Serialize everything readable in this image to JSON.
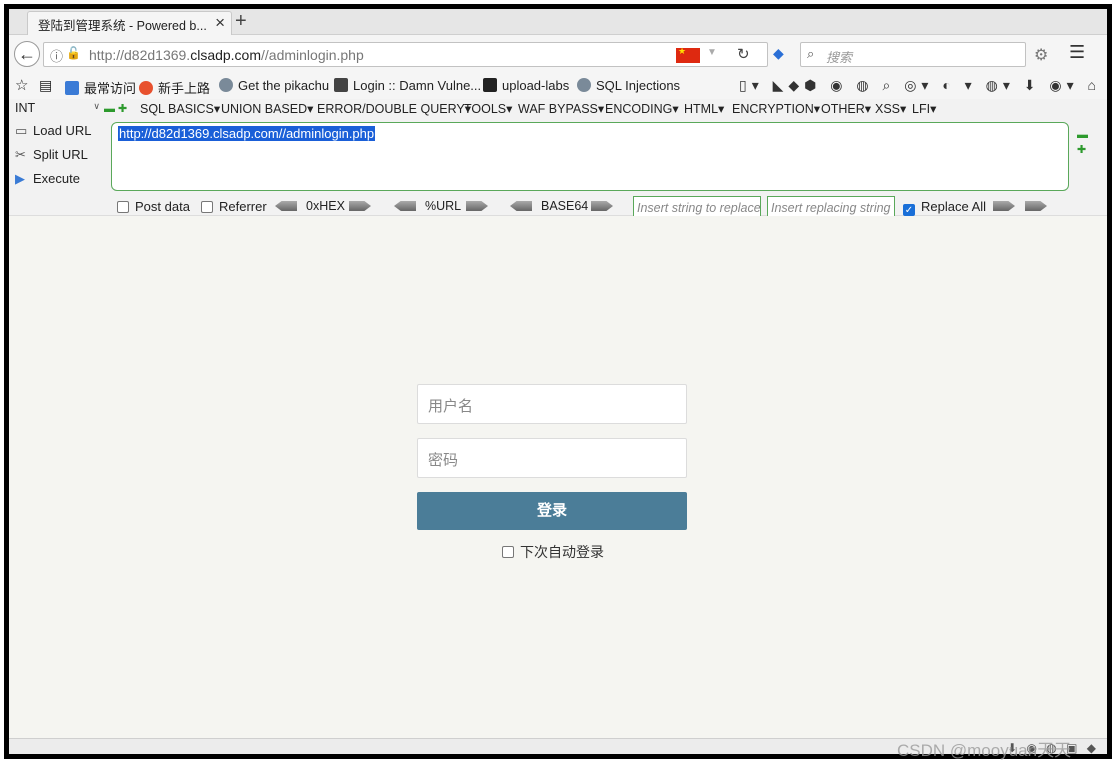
{
  "browser": {
    "tab_title": "登陆到管理系统 - Powered b...",
    "url_prefix": "http://d82d1369.",
    "url_domain": "clsadp.com",
    "url_path": "//adminlogin.php",
    "search_placeholder": "搜索"
  },
  "bookmarks": [
    {
      "label": "最常访问",
      "color": "#3b7bd6"
    },
    {
      "label": "新手上路",
      "color": "#e8512e"
    },
    {
      "label": "Get the pikachu",
      "color": "#7a8a99"
    },
    {
      "label": "Login :: Damn Vulne...",
      "color": "#444444"
    },
    {
      "label": "upload-labs",
      "color": "#222222"
    },
    {
      "label": "SQL Injections",
      "color": "#7a8a99"
    }
  ],
  "hackbar": {
    "type_select": "INT",
    "menus": [
      "SQL BASICS",
      "UNION BASED",
      "ERROR/DOUBLE QUERY",
      "TOOLS",
      "WAF BYPASS",
      "ENCODING",
      "HTML",
      "ENCRYPTION",
      "OTHER",
      "XSS",
      "LFI"
    ],
    "load_url": "Load URL",
    "split_url": "Split URL",
    "execute": "Execute",
    "url_value": "http://d82d1369.clsadp.com//adminlogin.php",
    "post_data": "Post data",
    "referrer": "Referrer",
    "hex": "0xHEX",
    "urlenc": "%URL",
    "base64": "BASE64",
    "replace_from_placeholder": "Insert string to replace",
    "replace_to_placeholder": "Insert replacing string",
    "replace_all": "Replace All"
  },
  "login": {
    "username_placeholder": "用户名",
    "password_placeholder": "密码",
    "submit_label": "登录",
    "remember_label": "下次自动登录"
  },
  "watermark": "CSDN @mooyuan天天",
  "colors": {
    "login_button": "#4b7d98",
    "hackbar_border": "#5aa85a",
    "selection": "#1a5fd8"
  }
}
